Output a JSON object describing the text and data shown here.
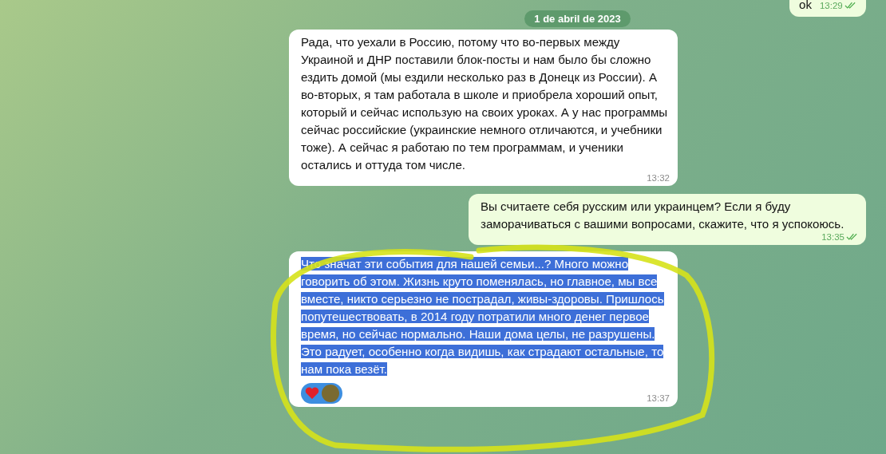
{
  "date_label": "1 de abril de 2023",
  "messages": [
    {
      "kind": "outgoing",
      "text": "ok",
      "time": "13:29",
      "read": true,
      "selected": false
    },
    {
      "kind": "date"
    },
    {
      "kind": "incoming",
      "text": "Рада, что уехали в Россию, потому что во-первых между Украиной и ДНР поставили блок-посты и нам было бы сложно ездить домой (мы ездили несколько раз в Донецк из России). А во-вторых, я там работала в школе и приобрела хороший опыт, который и сейчас использую на своих уроках. А у нас программы сейчас российские (украинские немного отличаются, и учебники тоже). А сейчас я работаю по тем программам, и ученики остались и оттуда  том числе.",
      "time": "13:32",
      "selected": false
    },
    {
      "kind": "outgoing",
      "text": "Вы считаете себя русским или украинцем? Если я буду заморачиваться с вашими вопросами, скажите, что я успокоюсь.",
      "time": "13:35",
      "read": true,
      "selected": false
    },
    {
      "kind": "incoming",
      "text": "Что значат эти события для нашей семьи...? Много можно говорить об этом. Жизнь круто поменялась, но главное, мы все вместе, никто серьезно не пострадал, живы-здоровы. Пришлось попутешествовать, в 2014 году потратили много денег первое время, но сейчас нормально. Наши дома целы, не разрушены. Это радует, особенно когда видишь, как страдают остальные, то нам пока везёт.",
      "time": "13:37",
      "selected": true,
      "reactions": [
        {
          "kind": "heart"
        },
        {
          "kind": "avatar"
        }
      ]
    }
  ]
}
